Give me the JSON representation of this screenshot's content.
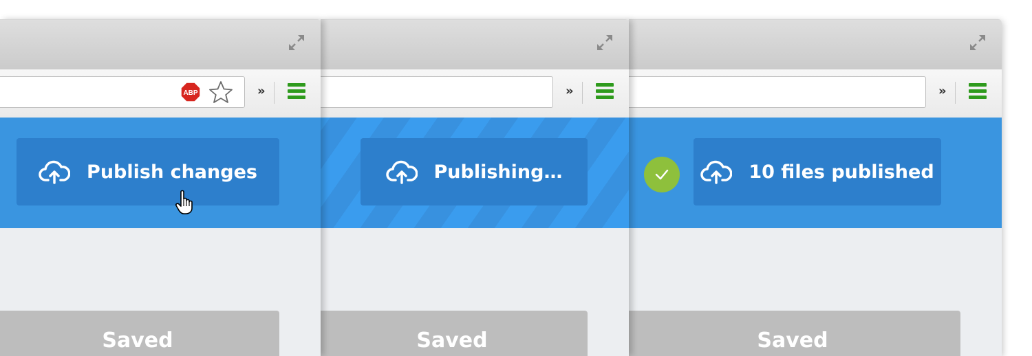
{
  "panels": [
    {
      "state": "idle",
      "publish_label": "Publish changes",
      "saved_label": "Saved",
      "overflow_chevron": "»",
      "toolbar_icons": [
        "abp-icon",
        "star-icon",
        "menu-icon"
      ]
    },
    {
      "state": "publishing",
      "publish_label": "Publishing…",
      "saved_label": "Saved",
      "overflow_chevron": "»",
      "toolbar_icons": [
        "menu-icon"
      ]
    },
    {
      "state": "published",
      "publish_label": "10 files published",
      "saved_label": "Saved",
      "overflow_chevron": "»",
      "toolbar_icons": [
        "check-icon",
        "menu-icon"
      ]
    }
  ],
  "abp_text": "ABP",
  "colors": {
    "banner": "#3a95e0",
    "button": "#2d7fcc",
    "success": "#8ec03c",
    "menu": "#2e9a1c",
    "saved": "#bdbdbd",
    "abp": "#d7261f"
  }
}
